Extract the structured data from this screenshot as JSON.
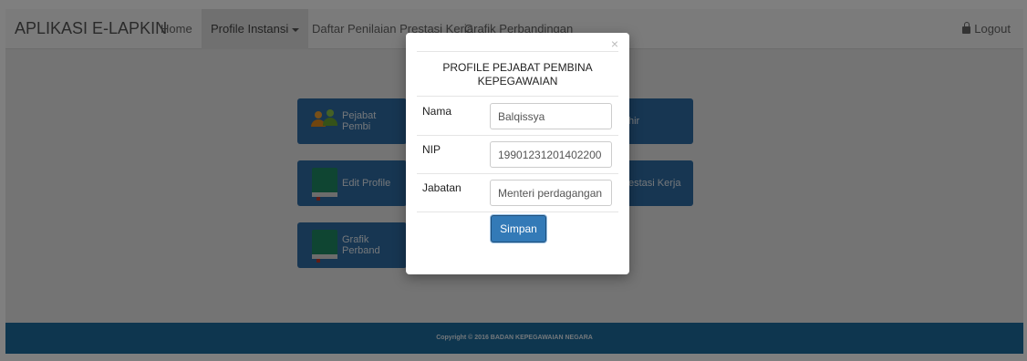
{
  "navbar": {
    "brand": "APLIKASI E-LAPKIN",
    "items": [
      {
        "label": "Home"
      },
      {
        "label": "Profile Instansi"
      },
      {
        "label": "Daftar Penilaian Prestasi Kerja"
      },
      {
        "label": "Grafik Perbandingan"
      }
    ],
    "logout": "Logout"
  },
  "tiles": [
    {
      "label": "Pejabat Pembi",
      "icon": "users-icon"
    },
    {
      "label": "Edit Profile",
      "icon": "book-icon"
    },
    {
      "label": "Grafik Perband",
      "icon": "book-icon"
    },
    {
      "label": "hir"
    },
    {
      "label": "estasi Kerja"
    }
  ],
  "footer": {
    "text": "Copyright © 2016 BADAN KEPEGAWAIAN NEGARA"
  },
  "modal": {
    "title": "PROFILE PEJABAT PEMBINA KEPEGAWAIAN",
    "close": "×",
    "fields": [
      {
        "label": "Nama",
        "value": "Balqissya"
      },
      {
        "label": "NIP",
        "value": "19901231201402200"
      },
      {
        "label": "Jabatan",
        "value": "Menteri perdagangan"
      }
    ],
    "submit": "Simpan"
  },
  "colors": {
    "tile": "#2e6da4",
    "footer": "#1d6c9e",
    "primary_button": "#337ab7"
  }
}
